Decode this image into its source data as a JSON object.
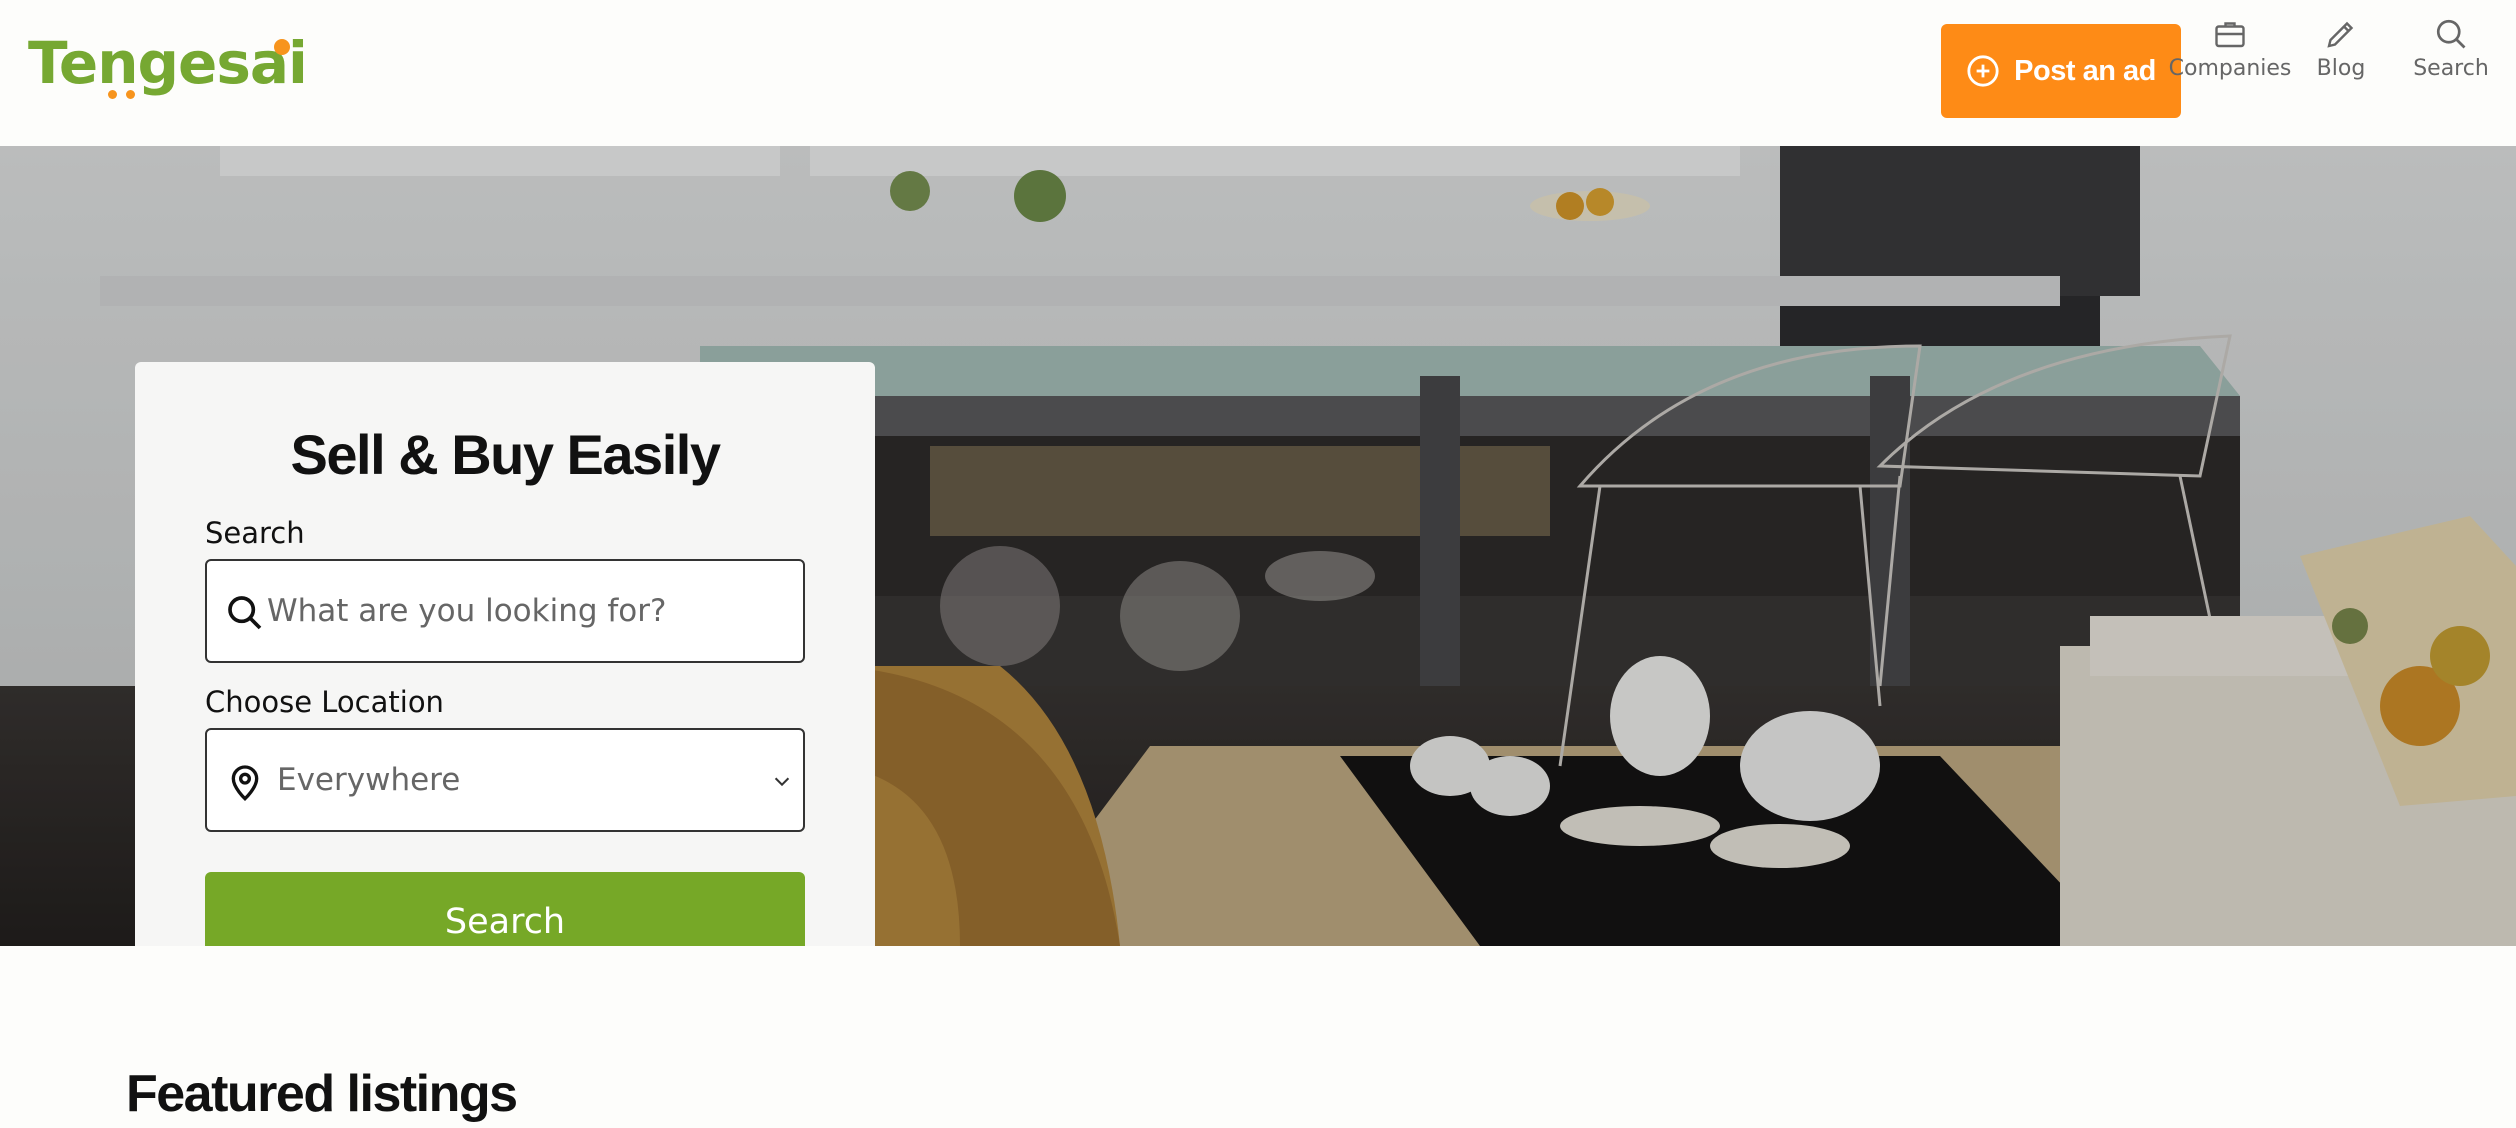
{
  "brand": {
    "name": "Tengesai",
    "primary_color": "#76a827",
    "accent_color": "#fe8b16"
  },
  "header": {
    "post_ad_label": "Post an ad",
    "nav": [
      {
        "label": "Companies",
        "icon": "briefcase-icon"
      },
      {
        "label": "Blog",
        "icon": "pencil-icon"
      },
      {
        "label": "Search",
        "icon": "search-icon"
      }
    ]
  },
  "hero": {
    "title": "Sell & Buy Easily",
    "search_label": "Search",
    "search_placeholder": "What are you looking for?",
    "location_label": "Choose Location",
    "location_value": "Everywhere",
    "submit_label": "Search"
  },
  "sections": {
    "featured_title": "Featured listings"
  }
}
